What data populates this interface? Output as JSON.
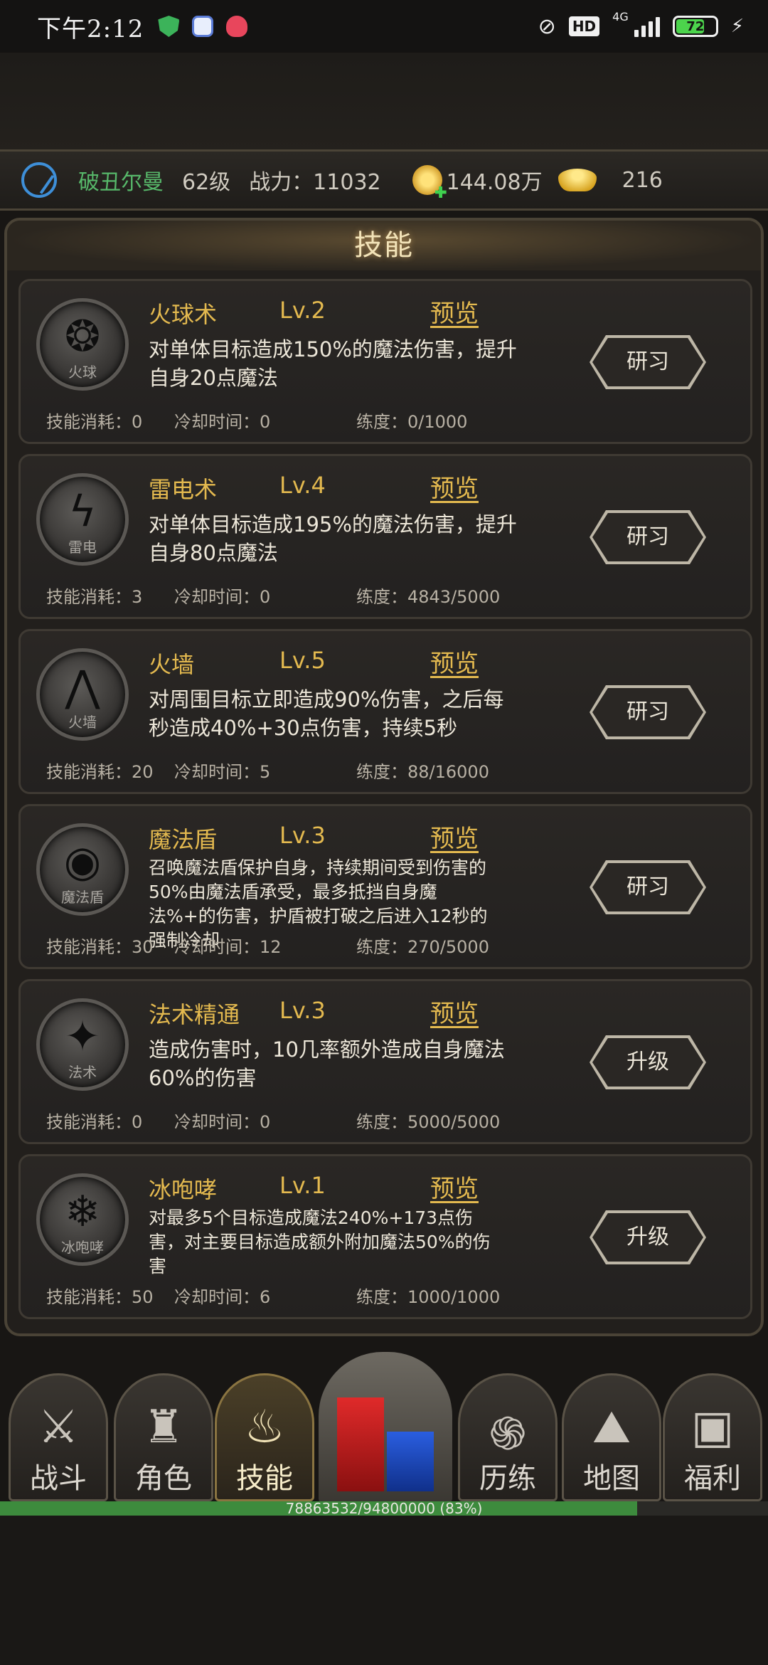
{
  "status_bar": {
    "time": "下午2:12",
    "hd": "HD",
    "network": "4G",
    "battery": "72",
    "battery_level": 0.72
  },
  "player": {
    "name": "破丑尔曼",
    "level": "62级",
    "power": "战力：11032",
    "coins": "144.08万",
    "ingots": "216"
  },
  "panel": {
    "title": "技能"
  },
  "stat_labels": {
    "cost": "技能消耗：",
    "cooldown": "冷却时间：",
    "proficiency": "练度："
  },
  "skills": [
    {
      "name": "火球术",
      "level": "Lv.2",
      "preview": "预览",
      "description": "对单体目标造成150%的魔法伤害，提升自身20点魔法",
      "cost": "技能消耗：0",
      "cooldown": "冷却时间：0",
      "proficiency": "练度：0/1000",
      "action": "研习",
      "icon_label": "火球",
      "icon": "fireball-icon"
    },
    {
      "name": "雷电术",
      "level": "Lv.4",
      "preview": "预览",
      "description": "对单体目标造成195%的魔法伤害，提升自身80点魔法",
      "cost": "技能消耗：3",
      "cooldown": "冷却时间：0",
      "proficiency": "练度：4843/5000",
      "action": "研习",
      "icon_label": "雷电",
      "icon": "lightning-icon"
    },
    {
      "name": "火墙",
      "level": "Lv.5",
      "preview": "预览",
      "description": "对周围目标立即造成90%伤害，之后每秒造成40%+30点伤害，持续5秒",
      "cost": "技能消耗：20",
      "cooldown": "冷却时间：5",
      "proficiency": "练度：88/16000",
      "action": "研习",
      "icon_label": "火墙",
      "icon": "firewall-icon"
    },
    {
      "name": "魔法盾",
      "level": "Lv.3",
      "preview": "预览",
      "description": "召唤魔法盾保护自身，持续期间受到伤害的50%由魔法盾承受，最多抵挡自身魔法%+的伤害，护盾被打破之后进入12秒的强制冷却",
      "cost": "技能消耗：30",
      "cooldown": "冷却时间：12",
      "proficiency": "练度：270/5000",
      "action": "研习",
      "icon_label": "魔法盾",
      "icon": "magic-shield-icon"
    },
    {
      "name": "法术精通",
      "level": "Lv.3",
      "preview": "预览",
      "description": "造成伤害时，10几率额外造成自身魔法60%的伤害",
      "cost": "技能消耗：0",
      "cooldown": "冷却时间：0",
      "proficiency": "练度：5000/5000",
      "action": "升级",
      "icon_label": "法术",
      "icon": "spell-mastery-icon"
    },
    {
      "name": "冰咆哮",
      "level": "Lv.1",
      "preview": "预览",
      "description": "对最多5个目标造成魔法240%+173点伤害，对主要目标造成额外附加魔法50%的伤害",
      "cost": "技能消耗：50",
      "cooldown": "冷却时间：6",
      "proficiency": "练度：1000/1000",
      "action": "升级",
      "icon_label": "冰咆哮",
      "icon": "ice-roar-icon"
    }
  ],
  "nav": [
    {
      "label": "战斗",
      "icon": "crossed-swords-icon"
    },
    {
      "label": "角色",
      "icon": "helmet-icon"
    },
    {
      "label": "技能",
      "icon": "flame-icon",
      "active": true
    },
    {
      "label": "历练",
      "icon": "vortex-icon"
    },
    {
      "label": "地图",
      "icon": "map-icon"
    },
    {
      "label": "福利",
      "icon": "treasure-chest-icon"
    }
  ],
  "xp": {
    "text": "78863532/94800000 (83%)",
    "fraction": 0.83
  },
  "colors": {
    "gold": "#e3b94f",
    "name_green": "#57b86a",
    "hp_red": "#e02a2a",
    "mp_blue": "#2a5ee0",
    "xp_green": "#3d8b3d"
  }
}
